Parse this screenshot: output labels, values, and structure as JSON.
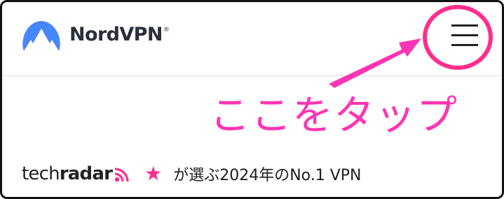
{
  "header": {
    "brand": "NordVPN",
    "trademark": "®",
    "logo_icon": "nordvpn-mountain-icon",
    "menu_icon": "hamburger-menu-icon"
  },
  "annotation": {
    "callout_text": "ここをタップ",
    "highlight_color": "#ff2e8c",
    "callout_color": "#ff35b3"
  },
  "footer": {
    "source_prefix": "tech",
    "source_suffix": "radar",
    "source_icon": "rss-feed-icon",
    "star_icon": "★",
    "award_text": "が選ぶ2024年のNo.1 VPN"
  },
  "colors": {
    "nord_blue": "#4687ff",
    "text_dark": "#2b2f3a",
    "accent_pink": "#ff2e8c"
  }
}
